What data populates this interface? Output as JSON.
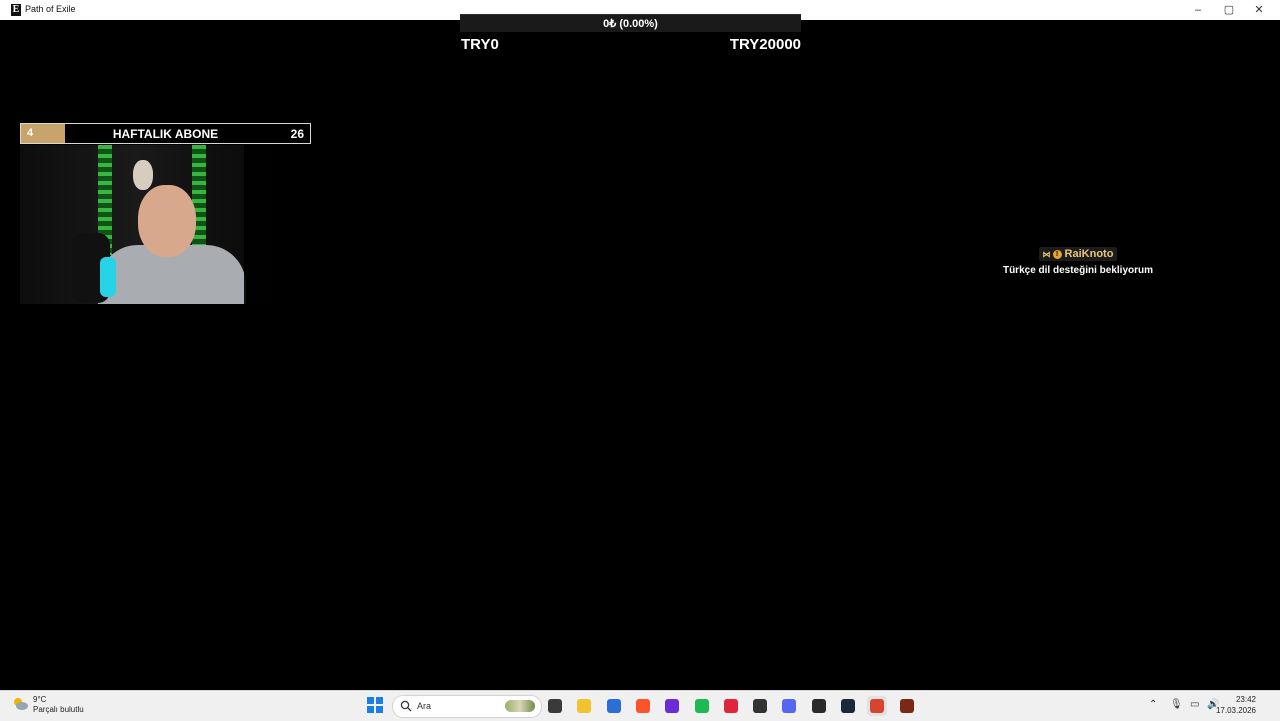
{
  "window": {
    "title": "Path of Exile",
    "icon_letter": "E",
    "controls": {
      "minimize": "–",
      "maximize": "▢",
      "close": "✕"
    }
  },
  "donation": {
    "percent_text": "0₺ (0.00%)",
    "progress_fraction": 0,
    "min_label": "TRY0",
    "max_label": "TRY20000",
    "fill_color": "#c9a46a"
  },
  "sub_goal": {
    "current": "4",
    "label": "HAFTALIK ABONE",
    "goal": "26",
    "progress_fraction": 0.1538,
    "fill_color": "#c9a46a"
  },
  "chat": {
    "username": "RaiKnoto",
    "message": "Türkçe dil desteğini bekliyorum",
    "username_color": "#e8c57a"
  },
  "taskbar": {
    "weather_temp": "9°C",
    "weather_desc": "Parçalı bulutlu",
    "search_placeholder": "Ara",
    "apps": [
      {
        "name": "task-view",
        "color": "#3a3a3a"
      },
      {
        "name": "file-explorer",
        "color": "#f2c12e"
      },
      {
        "name": "microsoft-store",
        "color": "#2b6fd6"
      },
      {
        "name": "brave-browser",
        "color": "#fb542b"
      },
      {
        "name": "nzxt-cam",
        "color": "#6a2bd8"
      },
      {
        "name": "spotify",
        "color": "#1db954"
      },
      {
        "name": "opera-gx",
        "color": "#e0243a"
      },
      {
        "name": "steelseries-gg",
        "color": "#333333"
      },
      {
        "name": "discord",
        "color": "#5865f2"
      },
      {
        "name": "obs-studio",
        "color": "#2a2a2a"
      },
      {
        "name": "steam",
        "color": "#1b2838"
      },
      {
        "name": "streaming-app",
        "color": "#d8452e"
      },
      {
        "name": "path-of-exile",
        "color": "#7a2a14"
      }
    ],
    "clock_time": "23:42",
    "clock_date": "17.03.2026"
  }
}
